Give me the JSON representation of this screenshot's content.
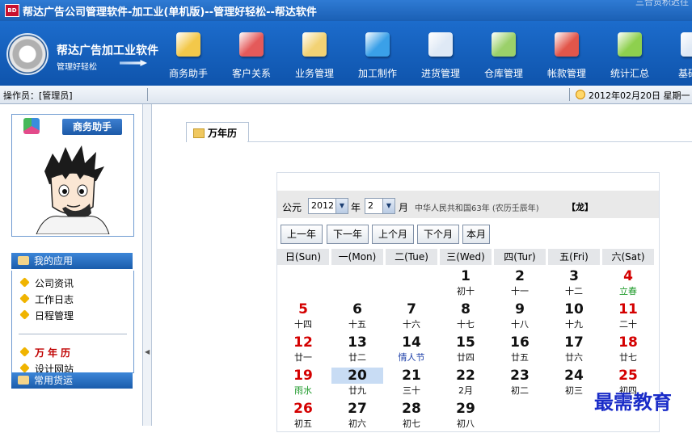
{
  "window": {
    "title": "帮达广告公司管理软件-加工业(单机版)--管理好轻松--帮达软件",
    "icon_text": "BD",
    "corner_text": "三合贡积迟往"
  },
  "logo": {
    "title": "帮达广告加工业软件",
    "subtitle": "管理好轻松"
  },
  "toolbar": {
    "items": [
      {
        "label": "商务助手",
        "icon": "signing-icon",
        "color": "#f3c84a"
      },
      {
        "label": "客户关系",
        "icon": "people-icon",
        "color": "#e45a5a"
      },
      {
        "label": "业务管理",
        "icon": "clipboard-icon",
        "color": "#f2d274"
      },
      {
        "label": "加工制作",
        "icon": "cubes-icon",
        "color": "#3aa0e8"
      },
      {
        "label": "进货管理",
        "icon": "notepad-icon",
        "color": "#dfe9f5"
      },
      {
        "label": "仓库管理",
        "icon": "warehouse-icon",
        "color": "#9bd06a"
      },
      {
        "label": "帐款管理",
        "icon": "ledger-icon",
        "color": "#e2564a"
      },
      {
        "label": "统计汇总",
        "icon": "chart-icon",
        "color": "#8ed04e"
      },
      {
        "label": "基础设",
        "icon": "settings-icon",
        "color": "#dfe9f5"
      }
    ]
  },
  "status": {
    "operator": "操作员：[管理员]",
    "date": "2012年02月20日 星期一"
  },
  "assistant": {
    "title": "商务助手"
  },
  "sections": {
    "my_apps": "我的应用",
    "common_goods": "常用货运"
  },
  "apps": [
    {
      "label": "公司资讯",
      "active": false
    },
    {
      "label": "工作日志",
      "active": false
    },
    {
      "label": "日程管理",
      "active": false
    },
    {
      "label": "万年历",
      "active": true
    },
    {
      "label": "设计网站",
      "active": false
    }
  ],
  "tab": {
    "label": "万年历"
  },
  "calendar": {
    "era_label": "公元",
    "year": "2012",
    "year_label": "年",
    "month": "2",
    "month_label": "月",
    "lunar_info": "中华人民共和国63年 (农历壬辰年)",
    "zodiac": "【龙】",
    "buttons": [
      "上一年",
      "下一年",
      "上个月",
      "下个月",
      "本月"
    ],
    "weekdays": [
      "日(Sun)",
      "一(Mon)",
      "二(Tue)",
      "三(Wed)",
      "四(Tur)",
      "五(Fri)",
      "六(Sat)"
    ],
    "days": [
      {
        "day": "1",
        "lunar": "初十",
        "col": 3,
        "row": 0
      },
      {
        "day": "2",
        "lunar": "十一",
        "col": 4,
        "row": 0
      },
      {
        "day": "3",
        "lunar": "十二",
        "col": 5,
        "row": 0
      },
      {
        "day": "4",
        "lunar": "立春",
        "col": 6,
        "row": 0,
        "lunar_style": "green"
      },
      {
        "day": "5",
        "lunar": "十四",
        "col": 0,
        "row": 1
      },
      {
        "day": "6",
        "lunar": "十五",
        "col": 1,
        "row": 1
      },
      {
        "day": "7",
        "lunar": "十六",
        "col": 2,
        "row": 1
      },
      {
        "day": "8",
        "lunar": "十七",
        "col": 3,
        "row": 1
      },
      {
        "day": "9",
        "lunar": "十八",
        "col": 4,
        "row": 1
      },
      {
        "day": "10",
        "lunar": "十九",
        "col": 5,
        "row": 1
      },
      {
        "day": "11",
        "lunar": "二十",
        "col": 6,
        "row": 1
      },
      {
        "day": "12",
        "lunar": "廿一",
        "col": 0,
        "row": 2
      },
      {
        "day": "13",
        "lunar": "廿二",
        "col": 1,
        "row": 2
      },
      {
        "day": "14",
        "lunar": "情人节",
        "col": 2,
        "row": 2,
        "lunar_style": "blue"
      },
      {
        "day": "15",
        "lunar": "廿四",
        "col": 3,
        "row": 2
      },
      {
        "day": "16",
        "lunar": "廿五",
        "col": 4,
        "row": 2
      },
      {
        "day": "17",
        "lunar": "廿六",
        "col": 5,
        "row": 2
      },
      {
        "day": "18",
        "lunar": "廿七",
        "col": 6,
        "row": 2
      },
      {
        "day": "19",
        "lunar": "雨水",
        "col": 0,
        "row": 3,
        "lunar_style": "green"
      },
      {
        "day": "20",
        "lunar": "廿九",
        "col": 1,
        "row": 3,
        "today": true
      },
      {
        "day": "21",
        "lunar": "三十",
        "col": 2,
        "row": 3
      },
      {
        "day": "22",
        "lunar": "2月",
        "col": 3,
        "row": 3
      },
      {
        "day": "23",
        "lunar": "初二",
        "col": 4,
        "row": 3
      },
      {
        "day": "24",
        "lunar": "初三",
        "col": 5,
        "row": 3
      },
      {
        "day": "25",
        "lunar": "初四",
        "col": 6,
        "row": 3
      },
      {
        "day": "26",
        "lunar": "初五",
        "col": 0,
        "row": 4
      },
      {
        "day": "27",
        "lunar": "初六",
        "col": 1,
        "row": 4
      },
      {
        "day": "28",
        "lunar": "初七",
        "col": 2,
        "row": 4
      },
      {
        "day": "29",
        "lunar": "初八",
        "col": 3,
        "row": 4
      }
    ]
  },
  "watermark": "最需教育"
}
